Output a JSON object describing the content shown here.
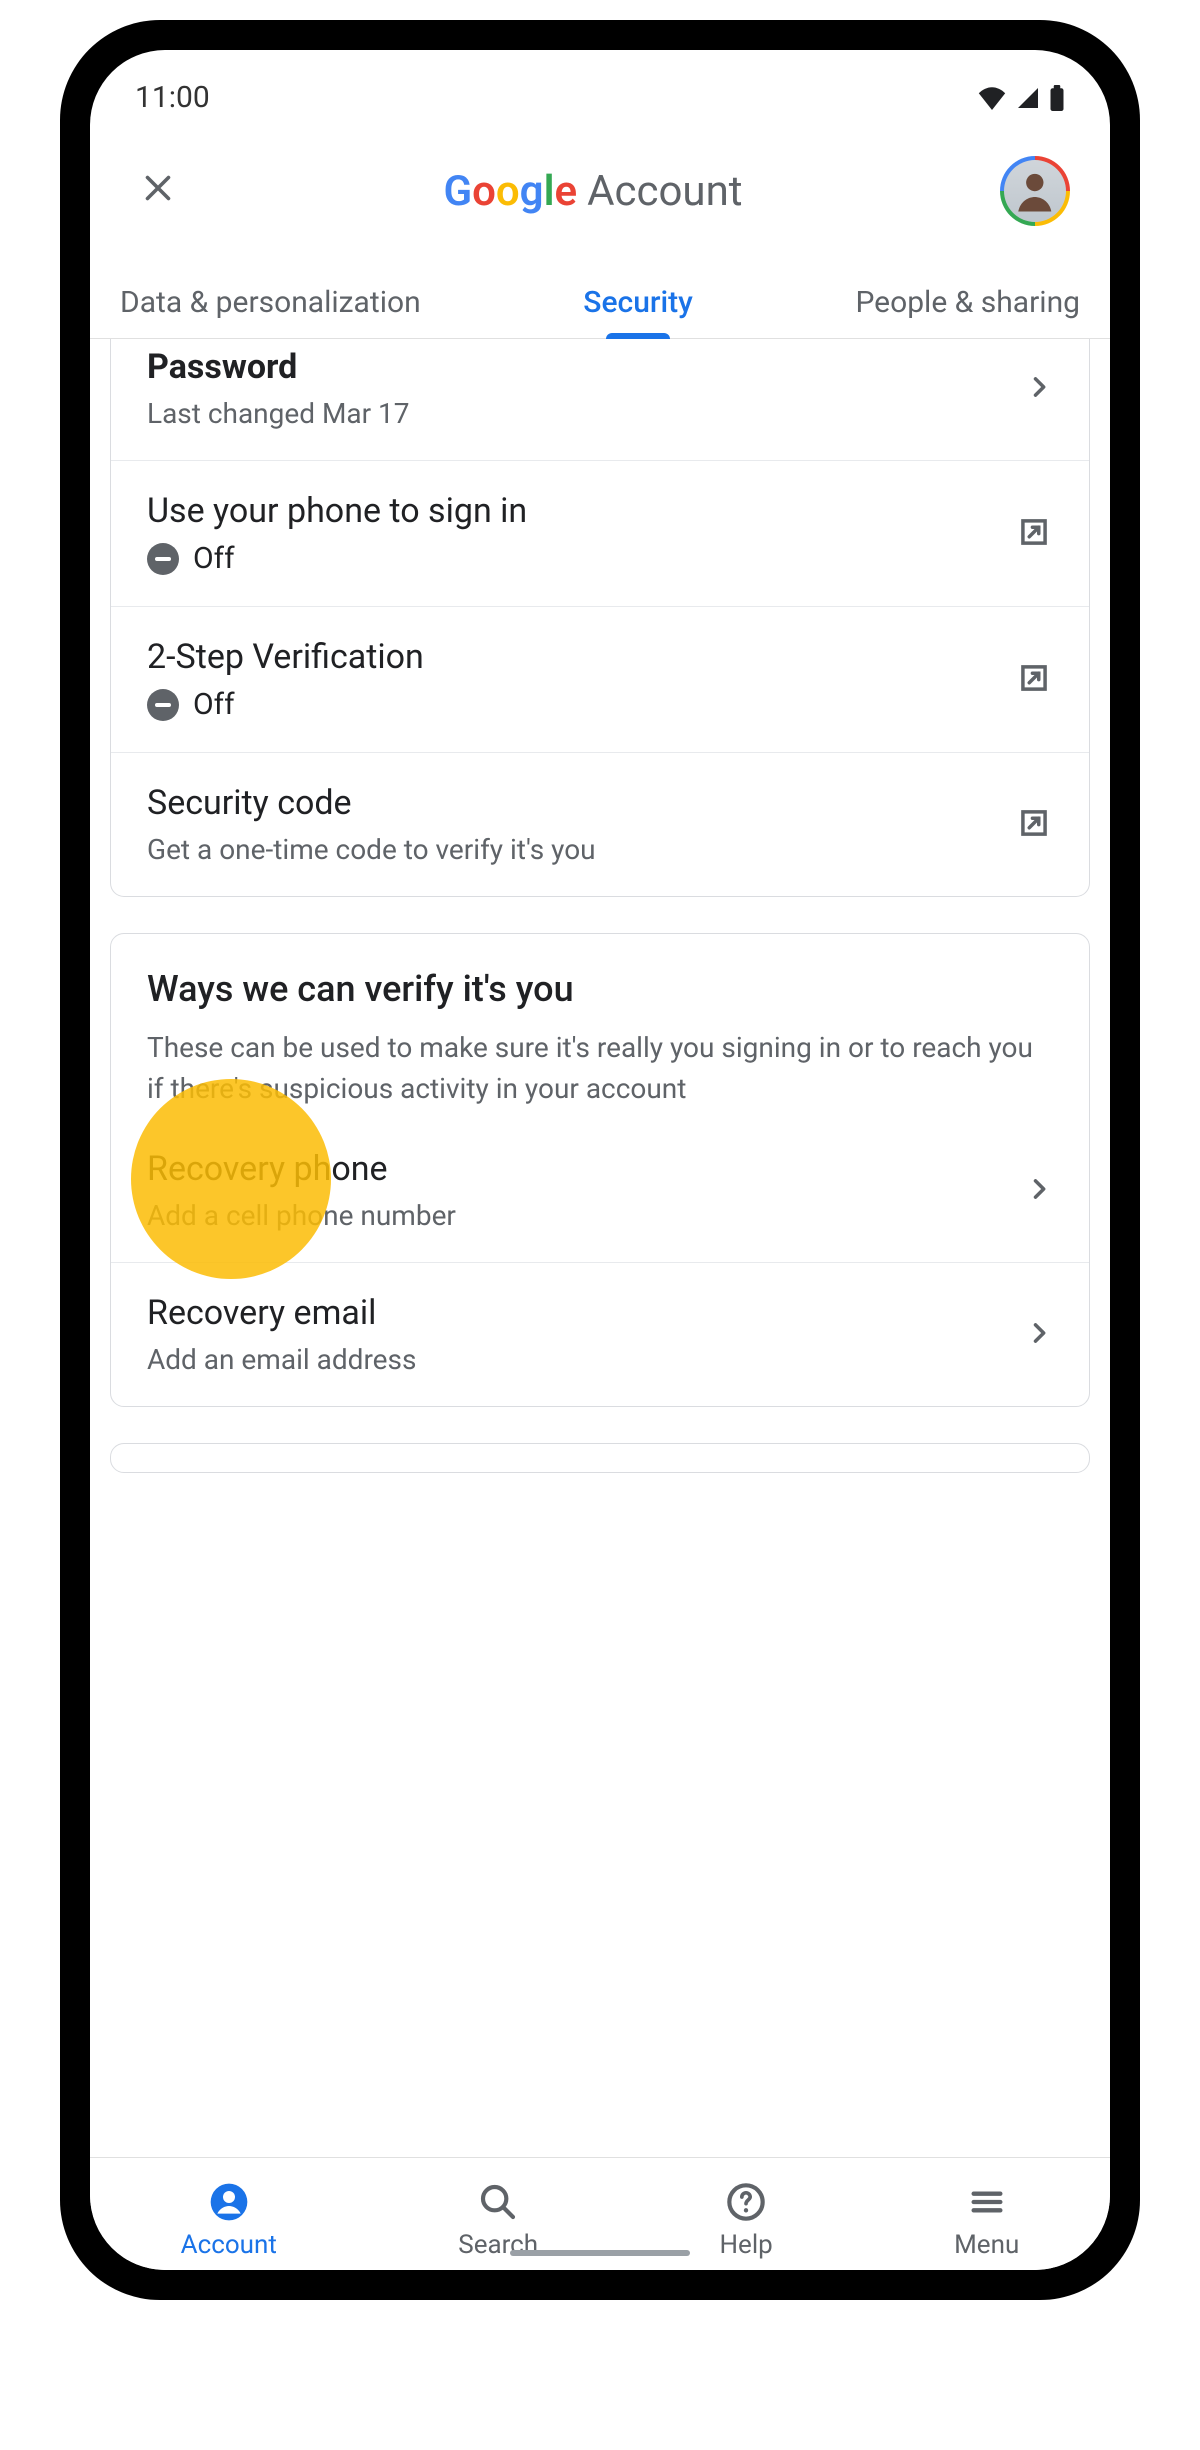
{
  "status": {
    "time": "11:00"
  },
  "header": {
    "title_account": "Account"
  },
  "tabs": {
    "data": "Data & personalization",
    "security": "Security",
    "people": "People & sharing"
  },
  "signin": {
    "password": {
      "title": "Password",
      "sub": "Last changed Mar 17"
    },
    "phone_signin": {
      "title": "Use your phone to sign in",
      "status": "Off"
    },
    "two_step": {
      "title": "2-Step Verification",
      "status": "Off"
    },
    "security_code": {
      "title": "Security code",
      "sub": "Get a one-time code to verify it's you"
    }
  },
  "verify": {
    "title": "Ways we can verify it's you",
    "desc": "These can be used to make sure it's really you signing in or to reach you if there's suspicious activity in your account",
    "recovery_phone": {
      "title": "Recovery phone",
      "sub": "Add a cell phone number"
    },
    "recovery_email": {
      "title": "Recovery email",
      "sub": "Add an email address"
    }
  },
  "nav": {
    "account": "Account",
    "search": "Search",
    "help": "Help",
    "menu": "Menu"
  }
}
